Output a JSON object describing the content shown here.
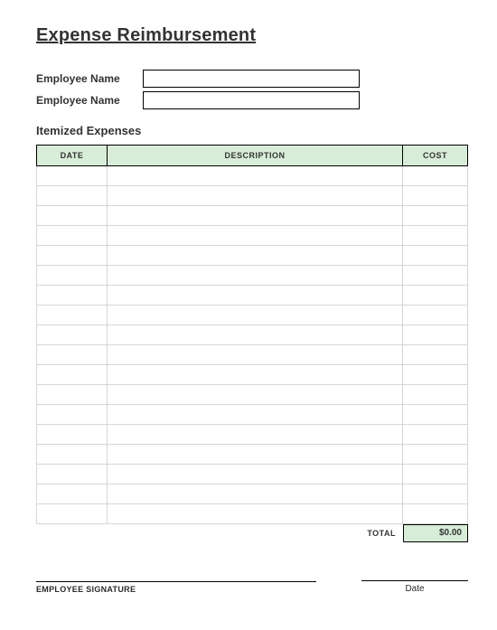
{
  "title": "Expense Reimbursement",
  "meta": {
    "label1": "Employee Name",
    "value1": "",
    "label2": "Employee Name",
    "value2": ""
  },
  "section_label": "Itemized Expenses",
  "columns": {
    "date": "DATE",
    "description": "DESCRIPTION",
    "cost": "COST"
  },
  "rows": [
    {
      "date": "",
      "description": "",
      "cost": ""
    },
    {
      "date": "",
      "description": "",
      "cost": ""
    },
    {
      "date": "",
      "description": "",
      "cost": ""
    },
    {
      "date": "",
      "description": "",
      "cost": ""
    },
    {
      "date": "",
      "description": "",
      "cost": ""
    },
    {
      "date": "",
      "description": "",
      "cost": ""
    },
    {
      "date": "",
      "description": "",
      "cost": ""
    },
    {
      "date": "",
      "description": "",
      "cost": ""
    },
    {
      "date": "",
      "description": "",
      "cost": ""
    },
    {
      "date": "",
      "description": "",
      "cost": ""
    },
    {
      "date": "",
      "description": "",
      "cost": ""
    },
    {
      "date": "",
      "description": "",
      "cost": ""
    },
    {
      "date": "",
      "description": "",
      "cost": ""
    },
    {
      "date": "",
      "description": "",
      "cost": ""
    },
    {
      "date": "",
      "description": "",
      "cost": ""
    },
    {
      "date": "",
      "description": "",
      "cost": ""
    },
    {
      "date": "",
      "description": "",
      "cost": ""
    },
    {
      "date": "",
      "description": "",
      "cost": ""
    }
  ],
  "total": {
    "label": "TOTAL",
    "value": "$0.00"
  },
  "signature": {
    "left": "EMPLOYEE SIGNATURE",
    "right": "Date"
  }
}
